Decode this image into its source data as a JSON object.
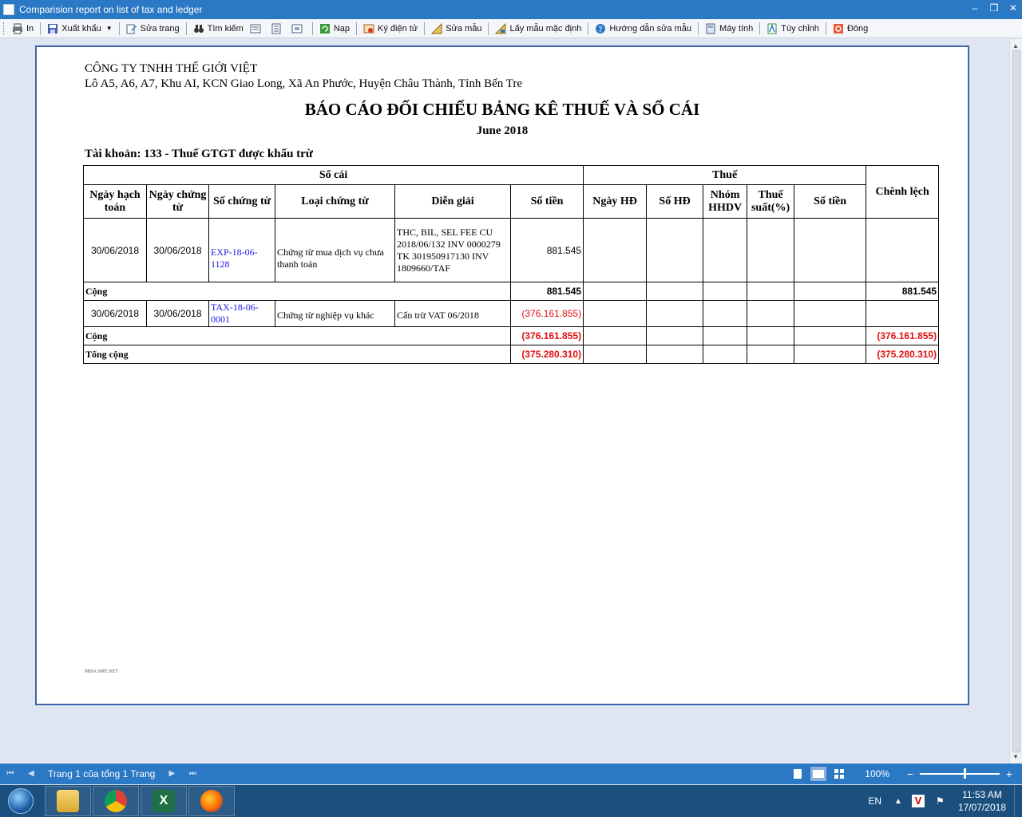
{
  "window": {
    "title": "Comparision report on list of tax and ledger"
  },
  "toolbar": {
    "items": [
      {
        "label": "In",
        "icon": "printer-icon"
      },
      {
        "label": "Xuất khẩu",
        "icon": "save-icon"
      },
      {
        "label": "Sửa trang",
        "icon": "edit-page-icon"
      },
      {
        "label": "Tìm kiếm",
        "icon": "binoculars-icon"
      },
      {
        "label": "Nạp",
        "icon": "refresh-icon"
      },
      {
        "label": "Ký điện tử",
        "icon": "digital-sign-icon"
      },
      {
        "label": "Sửa mẫu",
        "icon": "edit-template-icon"
      },
      {
        "label": "Lấy mẫu mặc định",
        "icon": "default-template-icon"
      },
      {
        "label": "Hướng dẫn sửa mẫu",
        "icon": "help-icon"
      },
      {
        "label": "Máy tính",
        "icon": "calculator-icon"
      },
      {
        "label": "Tùy chỉnh",
        "icon": "customize-icon"
      },
      {
        "label": "Đóng",
        "icon": "close-icon"
      }
    ]
  },
  "report": {
    "company_name": "CÔNG TY TNHH THẾ GIỚI VIỆT",
    "company_address": "Lô A5, A6, A7, Khu AI, KCN Giao Long, Xã An Phước, Huyện Châu Thành, Tỉnh Bến Tre",
    "title": "BÁO CÁO ĐỐI CHIẾU BẢNG KÊ THUẾ VÀ SỔ CÁI",
    "period": "June 2018",
    "account": "Tài khoản: 133 - Thuế GTGT được khấu trừ",
    "headers": {
      "group_ledger": "Sổ cái",
      "group_tax": "Thuế",
      "difference": "Chênh lệch",
      "posting_date": "Ngày hạch toán",
      "voucher_date": "Ngày chứng từ",
      "voucher_no": "Số chứng từ",
      "voucher_type": "Loại chứng từ",
      "description": "Diễn giải",
      "ledger_amount": "Số tiền",
      "invoice_date": "Ngày HĐ",
      "invoice_no": "Số HĐ",
      "service_group": "Nhóm HHDV",
      "tax_rate": "Thuế suất(%)",
      "tax_amount": "Số tiền"
    },
    "rows": [
      {
        "posting_date": "30/06/2018",
        "voucher_date": "30/06/2018",
        "voucher_no": "EXP-18-06-1128",
        "voucher_type": "Chứng từ mua dịch vụ chưa thanh toán",
        "description": "THC, BIL, SEL FEE CU 2018/06/132 INV 0000279 TK 301950917130 INV 1809660/TAF",
        "amount": "881.545"
      },
      {
        "posting_date": "30/06/2018",
        "voucher_date": "30/06/2018",
        "voucher_no": "TAX-18-06-0001",
        "voucher_type": "Chứng từ nghiệp vụ khác",
        "description": "Cấn trừ VAT 06/2018",
        "amount": "(376.161.855)"
      }
    ],
    "subtotal_label": "Cộng",
    "subtotals": [
      {
        "amount": "881.545",
        "difference": "881.545"
      },
      {
        "amount": "(376.161.855)",
        "difference": "(376.161.855)"
      }
    ],
    "total_label": "Tổng cộng",
    "total": {
      "amount": "(375.280.310)",
      "difference": "(375.280.310)"
    },
    "footer_mark": "MISA SME.NET"
  },
  "statusbar": {
    "page_info": "Trang 1 của tổng 1 Trang",
    "zoom": "100%",
    "zoom_level": 0.55
  },
  "taskbar": {
    "apps": [
      "file-explorer-icon",
      "chrome-icon",
      "excel-icon",
      "firefox-icon"
    ],
    "lang": "EN",
    "time": "11:53 AM",
    "date": "17/07/2018"
  },
  "colors": {
    "titlebar": "#2b78c4",
    "negative": "#e01010",
    "link": "#1a1ae6",
    "page_border": "#3c66a9"
  }
}
